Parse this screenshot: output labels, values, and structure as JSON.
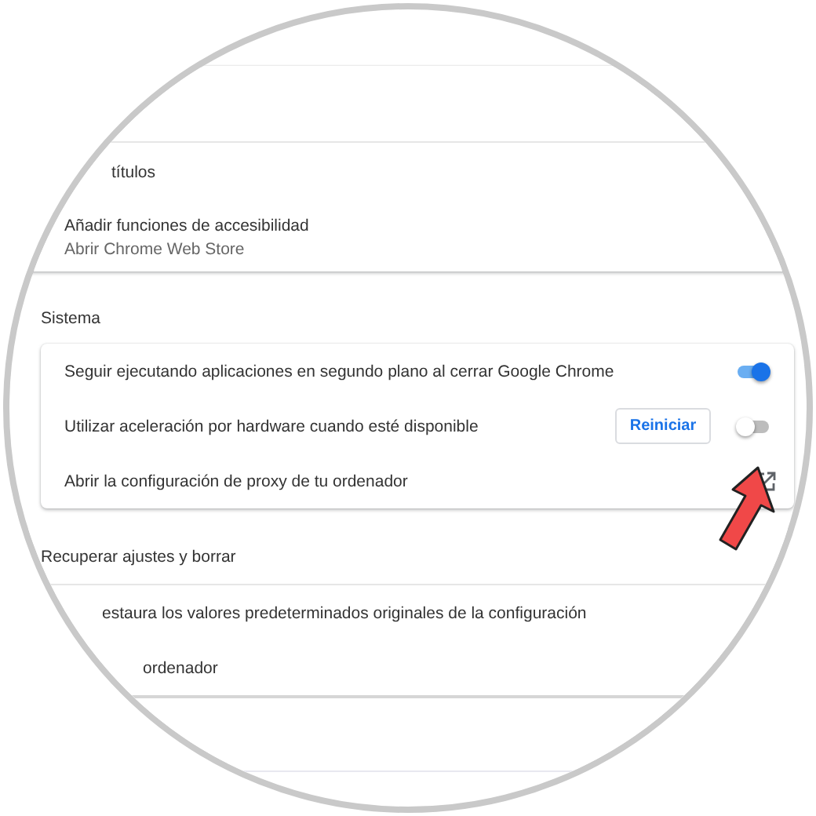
{
  "accessibility": {
    "rows": [
      {
        "kind": "plain",
        "label": "títulos"
      },
      {
        "kind": "link",
        "label": "Añadir funciones de accesibilidad",
        "sublabel": "Abrir Chrome Web Store"
      }
    ]
  },
  "system": {
    "heading": "Sistema",
    "rows": [
      {
        "kind": "toggle",
        "label": "Seguir ejecutando aplicaciones en segundo plano al cerrar Google Chrome",
        "on": true
      },
      {
        "kind": "toggle",
        "label": "Utilizar aceleración por hardware cuando esté disponible",
        "on": false,
        "button": "Reiniciar"
      },
      {
        "kind": "external",
        "label": "Abrir la configuración de proxy de tu ordenador"
      }
    ]
  },
  "reset": {
    "heading": "Recuperar ajustes y borrar",
    "rows": [
      {
        "kind": "plain",
        "label": "estaura los valores predeterminados originales de la configuración"
      },
      {
        "kind": "plain",
        "label": "ordenador"
      }
    ]
  }
}
